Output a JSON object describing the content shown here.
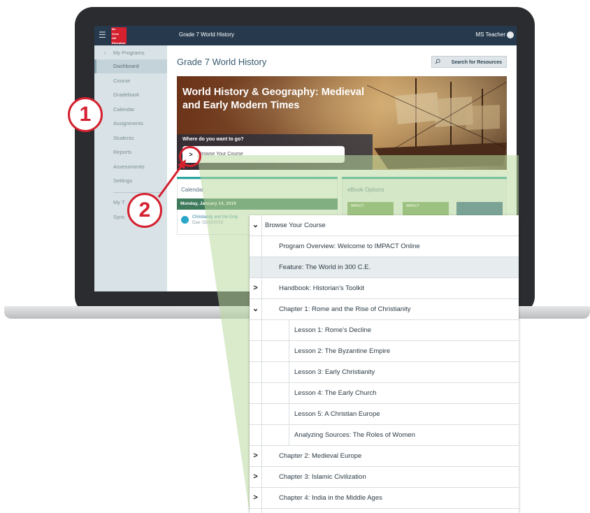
{
  "app": {
    "window_title": "Grade 7 World History",
    "user_name": "MS Teacher",
    "logo_lines": [
      "Mc",
      "Graw",
      "Hill",
      "Education"
    ]
  },
  "sidebar": {
    "back_label": "My Programs",
    "items": [
      {
        "label": "Dashboard",
        "active": true
      },
      {
        "label": "Course"
      },
      {
        "label": "Gradebook"
      },
      {
        "label": "Calendar"
      },
      {
        "label": "Assignments"
      },
      {
        "label": "Students"
      },
      {
        "label": "Reports"
      },
      {
        "label": "Assessments"
      },
      {
        "label": "Settings"
      },
      {
        "label": "My T"
      },
      {
        "label": "Sync"
      }
    ]
  },
  "main": {
    "title": "Grade 7 World History",
    "search_label": "Search for Resources",
    "hero": {
      "title_line1": "World History & Geography: Medieval",
      "title_line2": "and Early Modern Times",
      "question": "Where do you want to go?",
      "browse_label": "Browse Your Course"
    },
    "calendar": {
      "title": "Calendar",
      "date": "Monday, January 14, 2019",
      "event_title": "Christianity and the Emp",
      "event_due": "Due: 02/10/2019"
    },
    "ebook": {
      "title": "eBook Options",
      "tile_label": "IMPACT"
    }
  },
  "callouts": [
    "1",
    "2"
  ],
  "dropdown": {
    "header": "Browse Your Course",
    "rows": [
      {
        "label": "Program Overview: Welcome to IMPACT Online",
        "level": 1,
        "chevron": ""
      },
      {
        "label": "Feature: The World in 300 C.E.",
        "level": 1,
        "chevron": "",
        "highlight": true
      },
      {
        "label": "Handbook: Historian's Toolkit",
        "level": 1,
        "chevron": ">"
      },
      {
        "label": "Chapter 1: Rome and the Rise of Christianity",
        "level": 1,
        "chevron": "v"
      },
      {
        "label": "Lesson 1: Rome's Decline",
        "level": 2
      },
      {
        "label": "Lesson 2: The Byzantine Empire",
        "level": 2
      },
      {
        "label": "Lesson 3: Early Christianity",
        "level": 2
      },
      {
        "label": "Lesson 4: The Early Church",
        "level": 2
      },
      {
        "label": "Lesson 5: A Christian Europe",
        "level": 2
      },
      {
        "label": "Analyzing Sources: The Roles of Women",
        "level": 2
      },
      {
        "label": "Chapter 2: Medieval Europe",
        "level": 1,
        "chevron": ">"
      },
      {
        "label": "Chapter 3: Islamic Civilization",
        "level": 1,
        "chevron": ">"
      },
      {
        "label": "Chapter 4: India in the Middle Ages",
        "level": 1,
        "chevron": ">"
      }
    ]
  },
  "colors": {
    "topbar": "#273a4d",
    "callout_red": "#d4202f",
    "teal": "#2aa6a0",
    "cone_green": "#b9dba0"
  }
}
